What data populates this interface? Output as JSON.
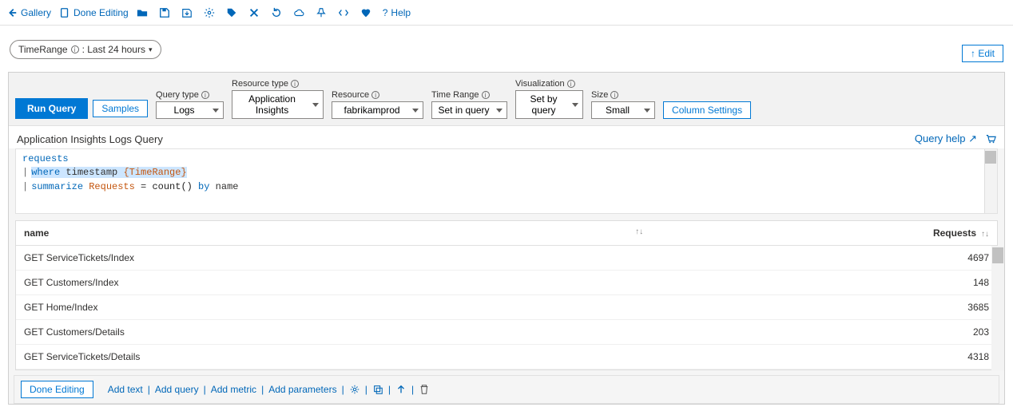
{
  "topbar": {
    "gallery": "Gallery",
    "done_editing": "Done Editing",
    "help": "Help"
  },
  "param": {
    "label": "TimeRange",
    "value": ": Last 24 hours"
  },
  "edit_button": "↑ Edit",
  "query": {
    "run": "Run Query",
    "samples": "Samples",
    "column_settings": "Column Settings",
    "fields": {
      "query_type": {
        "label": "Query type",
        "value": "Logs"
      },
      "resource_type": {
        "label": "Resource type",
        "value": "Application Insights"
      },
      "resource": {
        "label": "Resource",
        "value": "fabrikamprod"
      },
      "time_range": {
        "label": "Time Range",
        "value": "Set in query"
      },
      "visualization": {
        "label": "Visualization",
        "value": "Set by query"
      },
      "size": {
        "label": "Size",
        "value": "Small"
      }
    }
  },
  "subtitle": "Application Insights Logs Query",
  "query_help": "Query help",
  "code": {
    "l1": "requests",
    "l2_where": "where",
    "l2_ts": "timestamp",
    "l2_param": "{TimeRange}",
    "l3_sum": "summarize",
    "l3_req": "Requests",
    "l3_eq": " = ",
    "l3_count": "count()",
    "l3_by": " by ",
    "l3_name": "name"
  },
  "table": {
    "headers": {
      "name": "name",
      "requests": "Requests"
    },
    "rows": [
      {
        "name": "GET ServiceTickets/Index",
        "requests": "4697"
      },
      {
        "name": "GET Customers/Index",
        "requests": "148"
      },
      {
        "name": "GET Home/Index",
        "requests": "3685"
      },
      {
        "name": "GET Customers/Details",
        "requests": "203"
      },
      {
        "name": "GET ServiceTickets/Details",
        "requests": "4318"
      }
    ]
  },
  "footer": {
    "done_editing": "Done Editing",
    "add_text": "Add text",
    "add_query": "Add query",
    "add_metric": "Add metric",
    "add_parameters": "Add parameters"
  }
}
